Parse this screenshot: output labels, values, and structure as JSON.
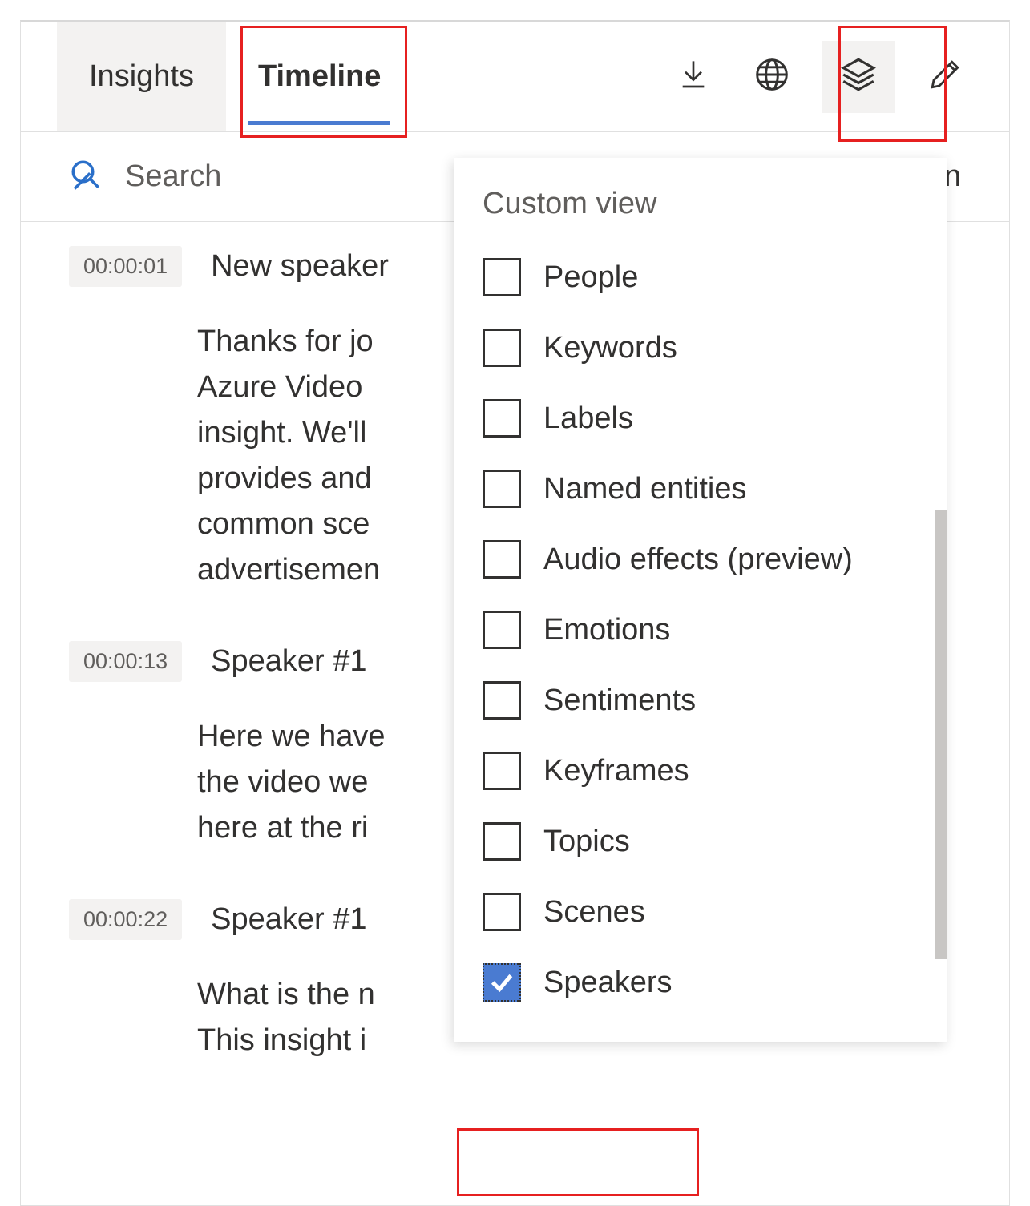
{
  "tabs": {
    "insights": "Insights",
    "timeline": "Timeline"
  },
  "search": {
    "placeholder": "Search"
  },
  "trailing_text": "l on",
  "segments": [
    {
      "time": "00:00:01",
      "speaker": "New speaker",
      "text": "Thanks for jo\nAzure Video\ninsight. We'll\nprovides and\ncommon sce\nadvertisemen"
    },
    {
      "time": "00:00:13",
      "speaker": "Speaker #1",
      "text": "Here we have\nthe video we\nhere at the ri"
    },
    {
      "time": "00:00:22",
      "speaker": "Speaker #1",
      "text": "What is the n\nThis insight i"
    }
  ],
  "dropdown": {
    "title": "Custom view",
    "items": [
      {
        "label": "People",
        "checked": false
      },
      {
        "label": "Keywords",
        "checked": false
      },
      {
        "label": "Labels",
        "checked": false
      },
      {
        "label": "Named entities",
        "checked": false
      },
      {
        "label": "Audio effects (preview)",
        "checked": false
      },
      {
        "label": "Emotions",
        "checked": false
      },
      {
        "label": "Sentiments",
        "checked": false
      },
      {
        "label": "Keyframes",
        "checked": false
      },
      {
        "label": "Topics",
        "checked": false
      },
      {
        "label": "Scenes",
        "checked": false
      },
      {
        "label": "Speakers",
        "checked": true
      }
    ]
  }
}
